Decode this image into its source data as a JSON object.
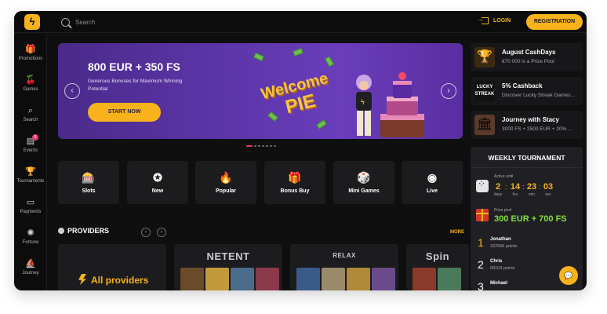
{
  "header": {
    "search_placeholder": "Search",
    "login_label": "LOGIN",
    "register_label": "REGISTRATION",
    "logo_icon": "bolt-logo-icon"
  },
  "sidebar": {
    "items": [
      {
        "label": "Promotions",
        "icon": "gift-icon",
        "glyph": "🎁"
      },
      {
        "label": "Games",
        "icon": "cherries-icon",
        "glyph": "🍒"
      },
      {
        "label": "Search",
        "icon": "search-icon",
        "glyph": "⌕"
      },
      {
        "label": "Events",
        "icon": "calendar-icon",
        "glyph": "▤",
        "badge": "6"
      },
      {
        "label": "Tournaments",
        "icon": "trophy-icon",
        "glyph": "🏆"
      },
      {
        "label": "Payments",
        "icon": "wallet-icon",
        "glyph": "▭"
      },
      {
        "label": "Fortune",
        "icon": "wheel-icon",
        "glyph": "✺"
      },
      {
        "label": "Journey",
        "icon": "ship-icon",
        "glyph": "⛵"
      }
    ]
  },
  "banner": {
    "title": "800 EUR + 350 FS",
    "subtitle": "Generous Bonuses for Maximum Winning Potential",
    "button": "START NOW",
    "art_line1": "Welcome",
    "art_line2": "PIE",
    "prev_glyph": "‹",
    "next_glyph": "›",
    "slides": 7,
    "active_slide": 1
  },
  "categories": [
    {
      "label": "Slots",
      "icon": "slot-machine-icon",
      "glyph": "🎰"
    },
    {
      "label": "New",
      "icon": "new-badge-icon",
      "glyph": "✪"
    },
    {
      "label": "Popular",
      "icon": "flame-icon",
      "glyph": "🔥"
    },
    {
      "label": "Bonus Buy",
      "icon": "gift-box-icon",
      "glyph": "🎁"
    },
    {
      "label": "Mini Games",
      "icon": "dice-icon",
      "glyph": "🎲"
    },
    {
      "label": "Live",
      "icon": "live-icon",
      "glyph": "◉"
    }
  ],
  "providers": {
    "title": "PROVIDERS",
    "more": "MORE",
    "all_label": "All providers",
    "cards": [
      "NETENT",
      "RELAX",
      "Spin"
    ],
    "prev_glyph": "‹",
    "next_glyph": "›"
  },
  "promos": [
    {
      "title": "August CashDays",
      "subtitle": "€70 000 is a Prize Pool",
      "icon": "trophy-icon",
      "glyph": "🏆"
    },
    {
      "title": "5% Cashback",
      "subtitle": "Discover Lucky Streak Games...",
      "icon": "lucky-streak-logo",
      "glyph": "LUCKY STREAK"
    },
    {
      "title": "Journey with Stacy",
      "subtitle": "3000 FS + 2500 EUR + 20% ...",
      "icon": "colosseum-icon",
      "glyph": "🏛"
    }
  ],
  "tournament": {
    "title": "WEEKLY TOURNAMENT",
    "active_label": "Active until",
    "countdown": [
      {
        "value": "2",
        "unit": "days"
      },
      {
        "value": "14",
        "unit": "hrs"
      },
      {
        "value": "23",
        "unit": "min"
      },
      {
        "value": "03",
        "unit": "sec"
      }
    ],
    "prize_label": "Prize pool",
    "prize_value": "300 EUR + 700 FS",
    "leaders": [
      {
        "rank": "1",
        "name": "Jonathan",
        "points": "322996 points"
      },
      {
        "rank": "2",
        "name": "Chris",
        "points": "68103 points"
      },
      {
        "rank": "3",
        "name": "Michael",
        "points": ""
      }
    ]
  },
  "chat": {
    "icon": "chat-bubble-icon",
    "glyph": "💬"
  },
  "colors": {
    "accent": "#f7b21c",
    "background": "#0f0f10",
    "banner": "#5c35a8",
    "prize": "#7ee03a"
  }
}
